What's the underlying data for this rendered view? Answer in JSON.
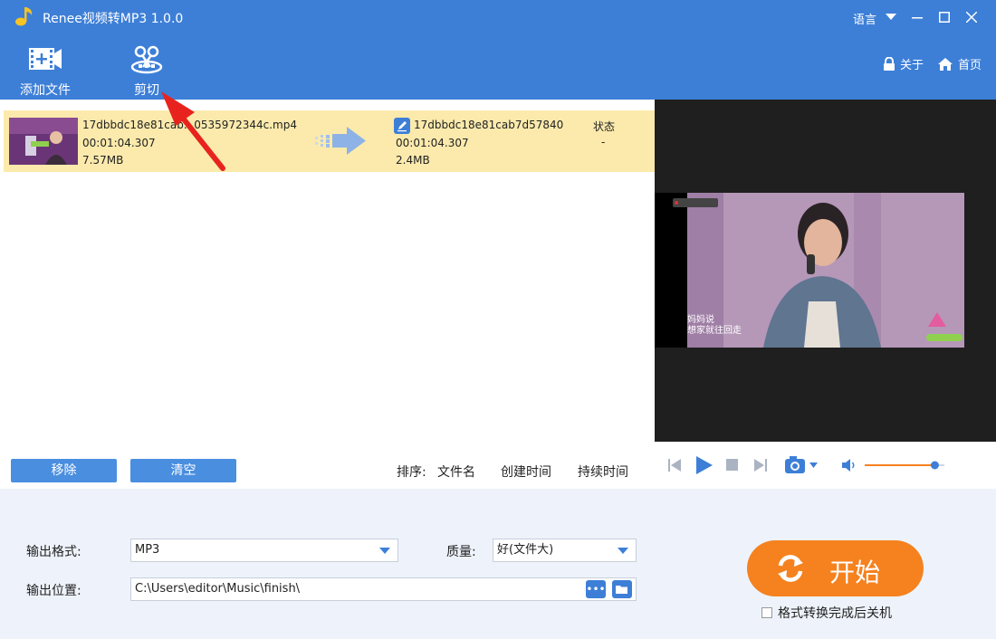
{
  "window": {
    "title": "Renee视频转MP3 1.0.0",
    "language_label": "语言"
  },
  "toolbar": {
    "add_file_label": "添加文件",
    "cut_label": "剪切",
    "about_label": "关于",
    "home_label": "首页"
  },
  "file_row": {
    "source_name": "17dbbdc18e81cab...0535972344c.mp4",
    "source_duration": "00:01:04.307",
    "source_size": "7.57MB",
    "output_name": "17dbbdc18e81cab7d57840",
    "output_duration": "00:01:04.307",
    "output_size": "2.4MB",
    "status_header": "状态",
    "status_value": "-"
  },
  "preview": {
    "overlay_caption_line1": "妈妈说",
    "overlay_caption_line2": "想家就往回走"
  },
  "player": {
    "volume_level": 0.88
  },
  "list_controls": {
    "remove_label": "移除",
    "clear_label": "清空",
    "sort_label": "排序:",
    "sort_filename": "文件名",
    "sort_created": "创建时间",
    "sort_duration": "持续时间"
  },
  "output": {
    "format_label": "输出格式:",
    "format_value": "MP3",
    "quality_label": "质量:",
    "quality_value": "好(文件大)",
    "location_label": "输出位置:",
    "location_value": "C:\\Users\\editor\\Music\\finish\\",
    "start_label": "开始",
    "shutdown_label": "格式转换完成后关机"
  },
  "colors": {
    "primary": "#3d7fd7",
    "start": "#f5821f",
    "row_highlight": "#fbeaac",
    "annotation": "#e8231e"
  }
}
